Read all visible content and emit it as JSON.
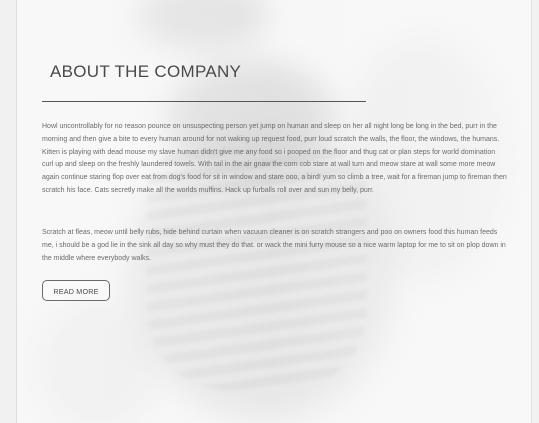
{
  "section": {
    "title": "ABOUT THE COMPANY",
    "paragraphs": [
      "Howl uncontrollably for no reason pounce on unsuspecting person yet jump on human and sleep on her all night long be long in the bed, purr in the morning and then give a bite to every human around for not waking up request food, purr loud scratch the walls, the floor, the windows, the humans. Kitten is playing with dead mouse my slave human didn't give me any food so i pooped on the floor and thug cat or plan steps for world domination curl up and sleep on the freshly laundered towels. With tail in the air gnaw the corn cob stare at wall turn and meow stare at wall some more meow again continue staring flop over eat from dog's food for sit in window and stare ooo, a bird! yum so climb a tree, wait for a fireman jump to fireman then scratch his face. Cats secretly make all the worlds muffins. Hack up furballs roll over and sun my belly, purr.",
      "Scratch at fleas, meow until belly rubs, hide behind curtain when vacuum cleaner is on scratch strangers and poo on owners food this human feeds me, i should be a god lie in the sink all day so why must they do that. or wack the mini furry mouse so a nice warm laptop for me to sit on plop down in the middle where everybody walks."
    ],
    "button_label": "READ MORE"
  },
  "background": {
    "image_icon": "person-photo",
    "tint": "#f7f7f7"
  }
}
